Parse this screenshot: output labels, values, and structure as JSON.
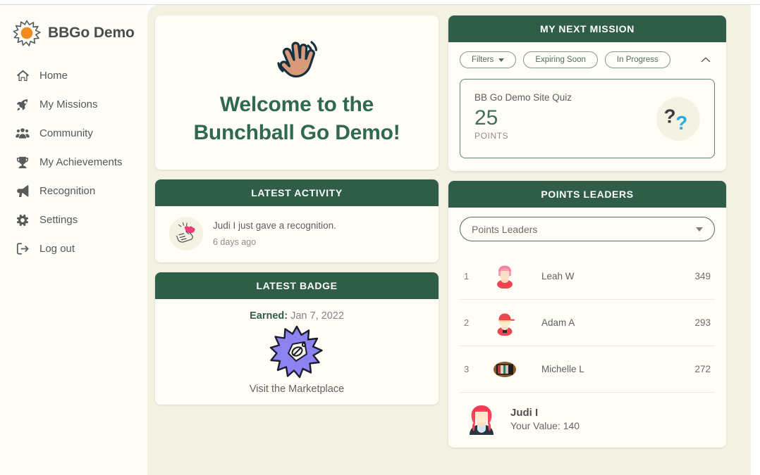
{
  "brand": {
    "name": "BBGo Demo",
    "logo_icon": "sunburst-logo-icon",
    "logo_color": "#F08C1E"
  },
  "sidebar": {
    "items": [
      {
        "label": "Home",
        "icon": "home-icon",
        "key": "home"
      },
      {
        "label": "My Missions",
        "icon": "rocket-icon",
        "key": "my-missions"
      },
      {
        "label": "Community",
        "icon": "users-icon",
        "key": "community"
      },
      {
        "label": "My Achievements",
        "icon": "trophy-icon",
        "key": "my-achievements"
      },
      {
        "label": "Recognition",
        "icon": "megaphone-icon",
        "key": "recognition"
      },
      {
        "label": "Settings",
        "icon": "gear-icon",
        "key": "settings"
      },
      {
        "label": "Log out",
        "icon": "sign-out-icon",
        "key": "log-out"
      }
    ]
  },
  "welcome": {
    "icon": "waving-hand-icon",
    "line1": "Welcome to the",
    "line2": "Bunchball Go Demo!"
  },
  "latest_activity": {
    "header": "LATEST ACTIVITY",
    "avatar_icon": "recognition-hands-icon",
    "message": "Judi I just gave a recognition.",
    "timestamp": "6 days ago"
  },
  "latest_badge": {
    "header": "LATEST BADGE",
    "earned_label": "Earned:",
    "earned_date": "Jan 7, 2022",
    "badge_icon": "purple-starburst-tag-badge-icon",
    "badge_name": "Visit the Marketplace"
  },
  "my_next_mission": {
    "header": "MY NEXT MISSION",
    "filters": [
      {
        "label": "Filters",
        "has_caret": true
      },
      {
        "label": "Expiring Soon",
        "has_caret": false
      },
      {
        "label": "In Progress",
        "has_caret": false
      }
    ],
    "collapse_icon": "chevron-up-icon",
    "mission": {
      "title": "BB Go Demo Site Quiz",
      "points": "25",
      "points_label": "POINTS",
      "art_icon": "double-question-mark-icon"
    }
  },
  "points_leaders": {
    "header": "POINTS LEADERS",
    "selected_option": "Points Leaders",
    "options": [
      "Points Leaders"
    ],
    "rows": [
      {
        "rank": "1",
        "name": "Leah W",
        "value": "349",
        "avatar": "avatar-pink-hair"
      },
      {
        "rank": "2",
        "name": "Adam A",
        "value": "293",
        "avatar": "avatar-red-cap"
      },
      {
        "rank": "3",
        "name": "Michelle L",
        "value": "272",
        "avatar": "avatar-dark-photo"
      }
    ],
    "me": {
      "name": "Judi I",
      "value_label": "Your Value: 140",
      "avatar": "avatar-red-hair"
    }
  },
  "colors": {
    "header_green": "#2F5D48",
    "title_green": "#2F6A4D",
    "page_bg": "#F3F2E2",
    "sidebar_bg": "#FDFCF7",
    "card_bg": "#FFFDF6",
    "accent_orange": "#F08C1E",
    "question_blue": "#29ABE2",
    "badge_purple": "#8C82F2"
  }
}
